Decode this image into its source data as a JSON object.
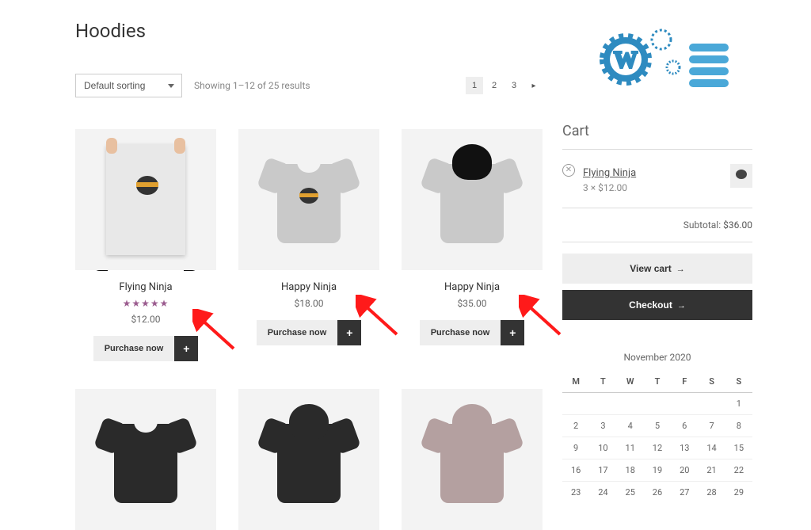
{
  "page_title": "Hoodies",
  "sort": {
    "selected": "Default sorting"
  },
  "result_count": "Showing 1–12 of 25 results",
  "pagination": {
    "pages": [
      "1",
      "2",
      "3"
    ],
    "current": "1",
    "next_symbol": "▸"
  },
  "purchase_label": "Purchase now",
  "plus_label": "+",
  "products": [
    {
      "title": "Flying Ninja",
      "price": "$12.00",
      "rating": "★★★★★",
      "style": "poster"
    },
    {
      "title": "Happy Ninja",
      "price": "$18.00",
      "rating": "",
      "style": "tshirt-grey"
    },
    {
      "title": "Happy Ninja",
      "price": "$35.00",
      "rating": "",
      "style": "hoodie-grey"
    },
    {
      "title": "",
      "price": "",
      "rating": "",
      "style": "tshirt-black"
    },
    {
      "title": "",
      "price": "",
      "rating": "",
      "style": "hoodie-black"
    },
    {
      "title": "",
      "price": "",
      "rating": "",
      "style": "hoodie-mauve"
    }
  ],
  "cart": {
    "heading": "Cart",
    "items": [
      {
        "name": "Flying Ninja",
        "qty_line": "3 × $12.00"
      }
    ],
    "subtotal_label": "Subtotal:",
    "subtotal_value": "$36.00",
    "view_cart_label": "View cart",
    "checkout_label": "Checkout",
    "arrow_symbol": "→"
  },
  "calendar": {
    "title": "November 2020",
    "dow": [
      "M",
      "T",
      "W",
      "T",
      "F",
      "S",
      "S"
    ],
    "weeks": [
      [
        "",
        "",
        "",
        "",
        "",
        "",
        "1"
      ],
      [
        "2",
        "3",
        "4",
        "5",
        "6",
        "7",
        "8"
      ],
      [
        "9",
        "10",
        "11",
        "12",
        "13",
        "14",
        "15"
      ],
      [
        "16",
        "17",
        "18",
        "19",
        "20",
        "21",
        "22"
      ],
      [
        "23",
        "24",
        "25",
        "26",
        "27",
        "28",
        "29"
      ]
    ]
  },
  "brand_name": "WordPress"
}
